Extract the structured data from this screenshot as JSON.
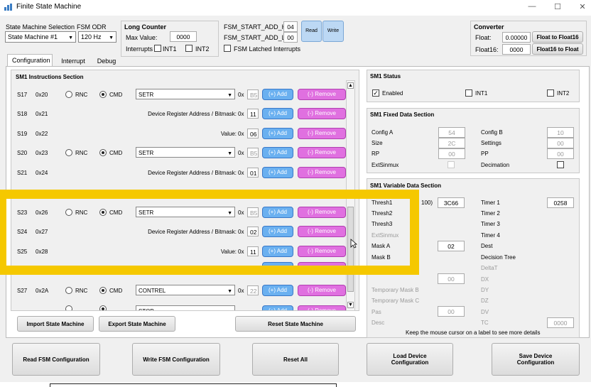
{
  "window": {
    "title": "Finite State Machine",
    "min": "—",
    "max": "☐",
    "close": "✕"
  },
  "top": {
    "sm_sel_label": "State Machine Selection",
    "sm_sel_value": "State Machine #1",
    "odr_label": "FSM ODR",
    "odr_value": "120 Hz",
    "long_counter_title": "Long Counter",
    "max_value_label": "Max Value:",
    "max_value": "0000",
    "interrupts_label": "Interrupts",
    "int1": "INT1",
    "int2": "INT2",
    "start_h_label": "FSM_START_ADD_H:",
    "start_h": "04",
    "start_l_label": "FSM_START_ADD_L:",
    "start_l": "00",
    "read": "Read",
    "write": "Write",
    "latched": "FSM Latched Interrupts",
    "converter_title": "Converter",
    "float_label": "Float:",
    "float_value": "0.00000",
    "f2f16": "Float to Float16",
    "float16_label": "Float16:",
    "float16_value": "0000",
    "f162f": "Float16 to Float"
  },
  "tabs": [
    "Configuration",
    "Interrupt",
    "Debug"
  ],
  "instr": {
    "title": "SM1 Instructions Section",
    "ox": "0x",
    "add": "(+) Add",
    "remove": "(-) Remove",
    "rnc": "RNC",
    "cmd": "CMD",
    "rows": [
      {
        "s": "S17",
        "a": "0x20",
        "type": "cmd",
        "sel": "SETR",
        "v": "B5"
      },
      {
        "s": "S18",
        "a": "0x21",
        "type": "label",
        "label": "Device Register Address / Bitmask:",
        "v": "11"
      },
      {
        "s": "S19",
        "a": "0x22",
        "type": "label",
        "label": "Value:",
        "v": "06"
      },
      {
        "s": "S20",
        "a": "0x23",
        "type": "cmd",
        "sel": "SETR",
        "v": "B5"
      },
      {
        "s": "S21",
        "a": "0x24",
        "type": "label",
        "label": "Device Register Address / Bitmask:",
        "v": "01"
      },
      {
        "s": "S23",
        "a": "0x26",
        "type": "cmd",
        "sel": "SETR",
        "v": "B5"
      },
      {
        "s": "S24",
        "a": "0x27",
        "type": "label",
        "label": "Device Register Address / Bitmask:",
        "v": "02"
      },
      {
        "s": "S25",
        "a": "0x28",
        "type": "label",
        "label": "Value:",
        "v": "11"
      },
      {
        "s": "S27",
        "a": "0x2A",
        "type": "cmd",
        "sel": "CONTREL",
        "v": "22"
      }
    ],
    "partial_sel": "STOP"
  },
  "status": {
    "title": "SM1 Status",
    "enabled": "Enabled",
    "int1": "INT1",
    "int2": "INT2"
  },
  "fixed": {
    "title": "SM1 Fixed Data Section",
    "rows": [
      {
        "l": "Config A",
        "v": "54",
        "l2": "Config B",
        "v2": "10"
      },
      {
        "l": "Size",
        "v": "2C",
        "l2": "Settings",
        "v2": "00"
      },
      {
        "l": "RP",
        "v": "00",
        "l2": "PP",
        "v2": "00"
      },
      {
        "l": "ExtSinmux",
        "l2": "Decimation"
      }
    ]
  },
  "variable": {
    "title": "SM1 Variable Data Section",
    "thresh1": "Thresh1",
    "thresh1_extra": "100)",
    "thresh1_v": "3C66",
    "timer1": "Timer 1",
    "timer1_v": "0258",
    "thresh2": "Thresh2",
    "timer2": "Timer 2",
    "thresh3": "Thresh3",
    "timer3": "Timer 3",
    "extsinmux": "ExtSinmux",
    "timer4": "Timer 4",
    "maska": "Mask A",
    "maska_v": "02",
    "dest": "Dest",
    "maskb": "Mask B",
    "dtree": "Decision Tree",
    "maskc": "Mask C",
    "deltat": "DeltaT",
    "v00a": "00",
    "dx": "DX",
    "tmb": "Temporary Mask B",
    "dy": "DY",
    "tmc": "Temporary Mask C",
    "dz": "DZ",
    "pas": "Pas",
    "pas_v": "00",
    "dv": "DV",
    "desc": "Desc",
    "tc": "TC",
    "tc_v": "0000",
    "hint": "Keep the mouse cursor on a label to see more details"
  },
  "buttons": {
    "import": "Import State Machine",
    "export": "Export State Machine",
    "reset_sm": "Reset State Machine",
    "read_fsm": "Read FSM Configuration",
    "write_fsm": "Write FSM Configuration",
    "reset_all": "Reset All",
    "load_dev": "Load Device Configuration",
    "save_dev": "Save Device Configuration"
  },
  "colors": {
    "highlight": "#f5c800",
    "add": "#6ab0f0",
    "remove": "#e070e0"
  }
}
